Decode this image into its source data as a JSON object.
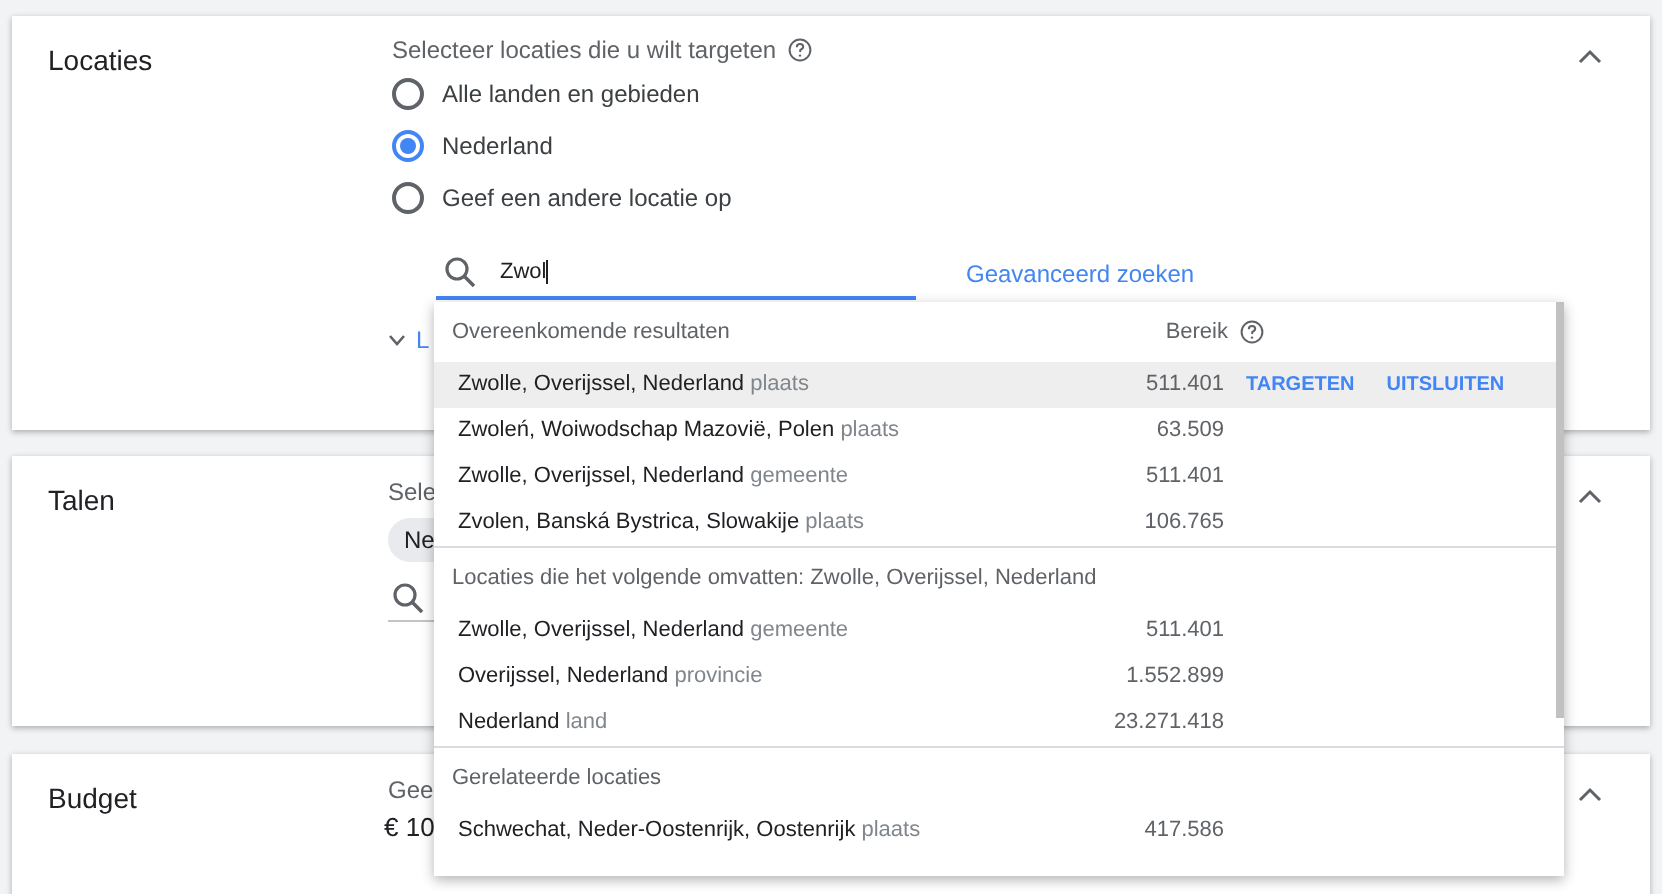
{
  "sections": [
    {
      "kind": "locations",
      "title": "Locaties",
      "expanded": true,
      "prompt": "Selecteer locaties die u wilt targeten",
      "options": [
        {
          "label": "Alle landen en gebieden",
          "selected": false
        },
        {
          "label": "Nederland",
          "selected": true
        },
        {
          "label": "Geef een andere locatie op",
          "selected": false
        }
      ],
      "search": {
        "value": "Zwol"
      },
      "advanced_link": "Geavanceerd zoeken",
      "more_link": "L"
    },
    {
      "kind": "languages",
      "title": "Talen",
      "expanded": true,
      "prompt": "Sele",
      "chip": "Ne"
    },
    {
      "kind": "budget",
      "title": "Budget",
      "expanded": true,
      "prompt": "Gee",
      "amount": "€ 10"
    }
  ],
  "dropdown": {
    "reach_header": "Bereik",
    "groups": [
      {
        "title": "Overeenkomende resultaten",
        "rows": [
          {
            "name": "Zwolle, Overijssel, Nederland",
            "type": "plaats",
            "reach": "511.401",
            "highlighted": true,
            "actions": [
              "TARGETEN",
              "UITSLUITEN"
            ]
          },
          {
            "name": "Zwoleń, Woiwodschap Mazovië, Polen",
            "type": "plaats",
            "reach": "63.509",
            "highlighted": false
          },
          {
            "name": "Zwolle, Overijssel, Nederland",
            "type": "gemeente",
            "reach": "511.401",
            "highlighted": false
          },
          {
            "name": "Zvolen, Banská Bystrica, Slowakije",
            "type": "plaats",
            "reach": "106.765",
            "highlighted": false
          }
        ]
      },
      {
        "title": "Locaties die het volgende omvatten: Zwolle, Overijssel, Nederland",
        "rows": [
          {
            "name": "Zwolle, Overijssel, Nederland",
            "type": "gemeente",
            "reach": "511.401",
            "highlighted": false
          },
          {
            "name": "Overijssel, Nederland",
            "type": "provincie",
            "reach": "1.552.899",
            "highlighted": false
          },
          {
            "name": "Nederland",
            "type": "land",
            "reach": "23.271.418",
            "highlighted": false
          }
        ]
      },
      {
        "title": "Gerelateerde locaties",
        "rows": [
          {
            "name": "Schwechat, Neder-Oostenrijk, Oostenrijk",
            "type": "plaats",
            "reach": "417.586",
            "highlighted": false
          }
        ]
      }
    ]
  }
}
